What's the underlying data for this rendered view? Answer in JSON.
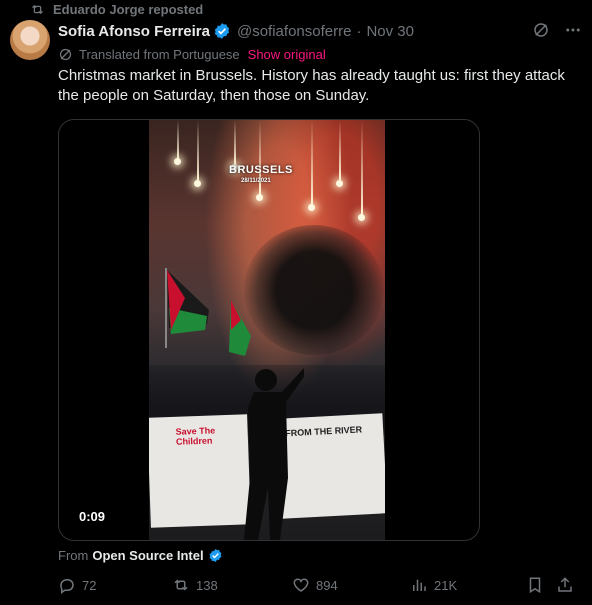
{
  "repost": {
    "label": "Eduardo Jorge reposted"
  },
  "author": {
    "name": "Sofia Afonso Ferreira",
    "handle": "@sofiafonsoferre",
    "separator": "·",
    "date": "Nov 30"
  },
  "translation": {
    "note": "Translated from Portuguese",
    "show_original": "Show original"
  },
  "tweet": {
    "text": "Christmas market in Brussels. History has already taught us: first they attack the people on Saturday, then those on Sunday."
  },
  "media": {
    "timestamp": "0:09",
    "overlay_city": "BRUSSELS",
    "overlay_date": "28/11/2021",
    "banner_left": "Save The Children",
    "banner_right": "FROM THE RIVER"
  },
  "source": {
    "prefix": "From",
    "name": "Open Source Intel"
  },
  "actions": {
    "replies": "72",
    "reposts": "138",
    "likes": "894",
    "views": "21K"
  },
  "colors": {
    "background": "#000000",
    "text": "#e7e9ea",
    "muted": "#71767b",
    "link": "#f91880",
    "verified": "#1d9bf0"
  },
  "icons": [
    "repost-icon",
    "verified-icon",
    "grok-icon",
    "more-icon",
    "translate-icon",
    "reply-icon",
    "retweet-icon",
    "like-icon",
    "views-icon",
    "bookmark-icon",
    "share-icon"
  ]
}
